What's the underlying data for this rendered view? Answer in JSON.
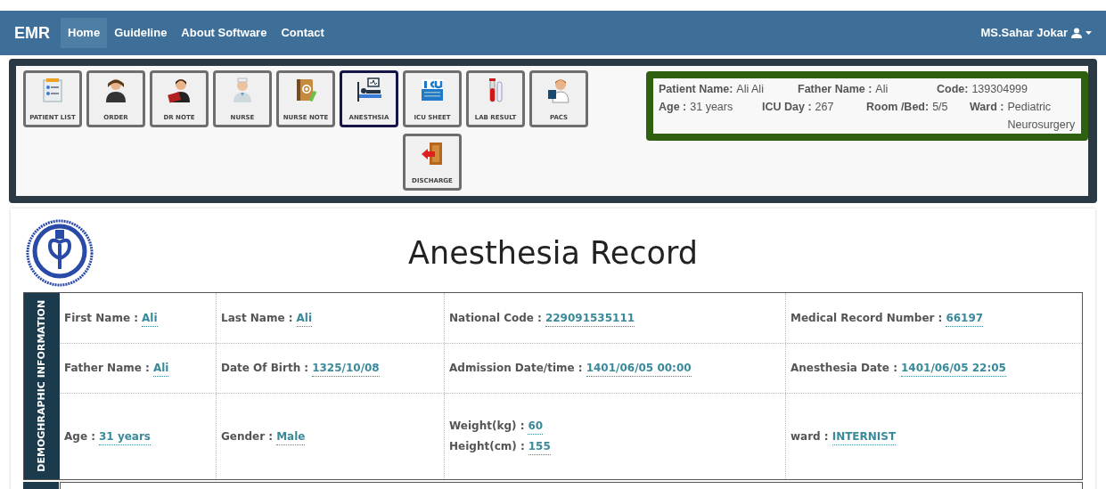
{
  "navbar": {
    "brand": "EMR",
    "items": [
      {
        "label": "Home",
        "selected": true
      },
      {
        "label": "Guideline",
        "selected": false
      },
      {
        "label": "About Software",
        "selected": false
      },
      {
        "label": "Contact",
        "selected": false
      }
    ],
    "user": "MS.Sahar Jokar"
  },
  "toolbar": [
    {
      "label": "PATIENT LIST",
      "selected": false
    },
    {
      "label": "ORDER",
      "selected": false
    },
    {
      "label": "DR NOTE",
      "selected": false
    },
    {
      "label": "NURSE",
      "selected": false
    },
    {
      "label": "NURSE NOTE",
      "selected": false
    },
    {
      "label": "ANESTHSIA",
      "selected": true
    },
    {
      "label": "ICU SHEET",
      "selected": false
    },
    {
      "label": "LAB RESULT",
      "selected": false
    },
    {
      "label": "PACS",
      "selected": false
    },
    {
      "label": "DISCHARGE",
      "selected": false
    }
  ],
  "patient_info": [
    [
      {
        "label": "Patient Name:",
        "value": "Ali Ali"
      },
      {
        "label": "Father Name :",
        "value": "Ali"
      },
      {
        "label": "Code:",
        "value": "139304999"
      }
    ],
    [
      {
        "label": "Age :",
        "value": "31 years"
      },
      {
        "label": "ICU Day :",
        "value": "267"
      },
      {
        "label": "Room /Bed:",
        "value": "5/5"
      },
      {
        "label": "Ward :",
        "value": "Pediatric Neurosurgery"
      }
    ]
  ],
  "record": {
    "title": "Anesthesia Record",
    "section": "DEMOGHRAPHIC INFORMATION",
    "rows": [
      [
        [
          {
            "label": "First Name :",
            "value": "Ali"
          }
        ],
        [
          {
            "label": "Last Name :",
            "value": "Ali"
          }
        ],
        [
          {
            "label": "National Code :",
            "value": "229091535111"
          }
        ],
        [
          {
            "label": "Medical Record Number :",
            "value": "66197"
          }
        ]
      ],
      [
        [
          {
            "label": "Father Name :",
            "value": "Ali"
          }
        ],
        [
          {
            "label": "Date Of Birth :",
            "value": "1325/10/08"
          }
        ],
        [
          {
            "label": "Admission Date/time :",
            "value": "1401/06/05 00:00"
          }
        ],
        [
          {
            "label": "Anesthesia Date :",
            "value": "1401/06/05 22:05"
          }
        ]
      ],
      [
        [
          {
            "label": "Age :",
            "value": "31 years"
          }
        ],
        [
          {
            "label": "Gender :",
            "value": "Male"
          }
        ],
        [
          {
            "label": "Weight(kg) :",
            "value": "60"
          },
          {
            "label": "Height(cm) :",
            "value": "155"
          }
        ],
        [
          {
            "label": "ward :",
            "value": "INTERNIST"
          }
        ]
      ]
    ]
  }
}
